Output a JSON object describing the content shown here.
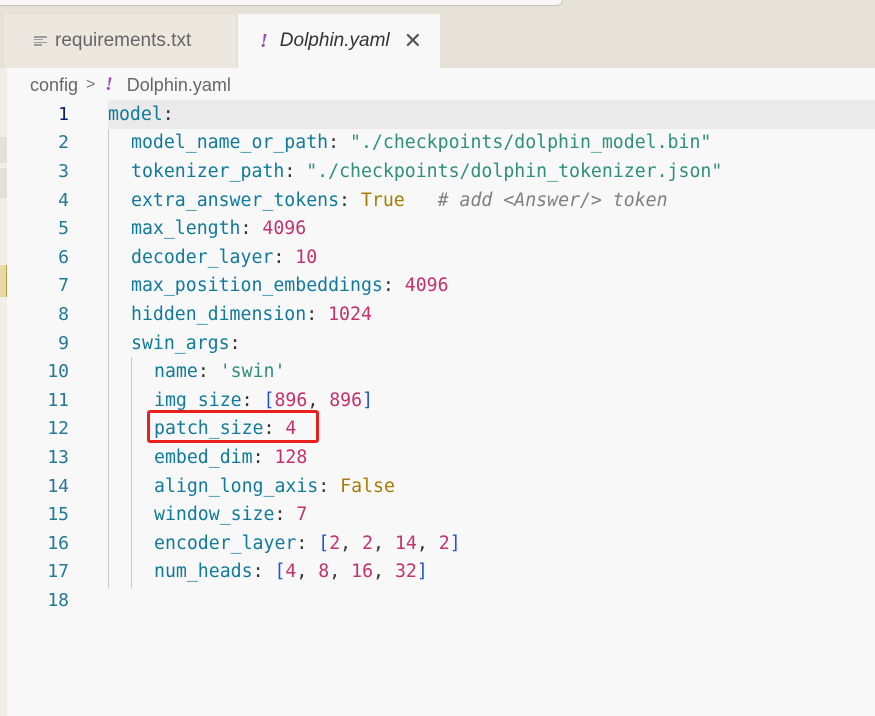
{
  "tabs": [
    {
      "label": "requirements.txt",
      "active": false
    },
    {
      "label": "Dolphin.yaml",
      "active": true,
      "icon": "!"
    }
  ],
  "breadcrumb": {
    "folder": "config",
    "separator": ">",
    "icon": "!",
    "file": "Dolphin.yaml"
  },
  "lines": [
    {
      "n": "1",
      "indent": 0,
      "tokens": [
        [
          "k",
          "model"
        ],
        [
          "p",
          ":"
        ]
      ]
    },
    {
      "n": "2",
      "indent": 1,
      "tokens": [
        [
          "k",
          "model_name_or_path"
        ],
        [
          "p",
          ": "
        ],
        [
          "s",
          "\"./checkpoints/dolphin_model.bin\""
        ]
      ]
    },
    {
      "n": "3",
      "indent": 1,
      "tokens": [
        [
          "k",
          "tokenizer_path"
        ],
        [
          "p",
          ": "
        ],
        [
          "s",
          "\"./checkpoints/dolphin_tokenizer.json\""
        ]
      ]
    },
    {
      "n": "4",
      "indent": 1,
      "tokens": [
        [
          "k",
          "extra_answer_tokens"
        ],
        [
          "p",
          ": "
        ],
        [
          "b",
          "True"
        ],
        [
          "p",
          "   "
        ],
        [
          "c",
          "# add <Answer/> token"
        ]
      ]
    },
    {
      "n": "5",
      "indent": 1,
      "tokens": [
        [
          "k",
          "max_length"
        ],
        [
          "p",
          ": "
        ],
        [
          "n",
          "4096"
        ]
      ]
    },
    {
      "n": "6",
      "indent": 1,
      "tokens": [
        [
          "k",
          "decoder_layer"
        ],
        [
          "p",
          ": "
        ],
        [
          "n",
          "10"
        ]
      ]
    },
    {
      "n": "7",
      "indent": 1,
      "tokens": [
        [
          "k",
          "max_position_embeddings"
        ],
        [
          "p",
          ": "
        ],
        [
          "n",
          "4096"
        ]
      ]
    },
    {
      "n": "8",
      "indent": 1,
      "tokens": [
        [
          "k",
          "hidden_dimension"
        ],
        [
          "p",
          ": "
        ],
        [
          "n",
          "1024"
        ]
      ]
    },
    {
      "n": "9",
      "indent": 1,
      "tokens": [
        [
          "k",
          "swin_args"
        ],
        [
          "p",
          ":"
        ]
      ]
    },
    {
      "n": "10",
      "indent": 2,
      "tokens": [
        [
          "k",
          "name"
        ],
        [
          "p",
          ": "
        ],
        [
          "s",
          "'swin'"
        ]
      ]
    },
    {
      "n": "11",
      "indent": 2,
      "tokens": [
        [
          "k",
          "img_size"
        ],
        [
          "p",
          ": "
        ],
        [
          "br",
          "["
        ],
        [
          "n",
          "896"
        ],
        [
          "p",
          ", "
        ],
        [
          "n",
          "896"
        ],
        [
          "br",
          "]"
        ]
      ]
    },
    {
      "n": "12",
      "indent": 2,
      "tokens": [
        [
          "k",
          "patch_size"
        ],
        [
          "p",
          ": "
        ],
        [
          "n",
          "4"
        ]
      ]
    },
    {
      "n": "13",
      "indent": 2,
      "tokens": [
        [
          "k",
          "embed_dim"
        ],
        [
          "p",
          ": "
        ],
        [
          "n",
          "128"
        ]
      ]
    },
    {
      "n": "14",
      "indent": 2,
      "tokens": [
        [
          "k",
          "align_long_axis"
        ],
        [
          "p",
          ": "
        ],
        [
          "b",
          "False"
        ]
      ]
    },
    {
      "n": "15",
      "indent": 2,
      "tokens": [
        [
          "k",
          "window_size"
        ],
        [
          "p",
          ": "
        ],
        [
          "n",
          "7"
        ]
      ]
    },
    {
      "n": "16",
      "indent": 2,
      "tokens": [
        [
          "k",
          "encoder_layer"
        ],
        [
          "p",
          ": "
        ],
        [
          "br",
          "["
        ],
        [
          "n",
          "2"
        ],
        [
          "p",
          ", "
        ],
        [
          "n",
          "2"
        ],
        [
          "p",
          ", "
        ],
        [
          "n",
          "14"
        ],
        [
          "p",
          ", "
        ],
        [
          "n",
          "2"
        ],
        [
          "br",
          "]"
        ]
      ]
    },
    {
      "n": "17",
      "indent": 2,
      "tokens": [
        [
          "k",
          "num_heads"
        ],
        [
          "p",
          ": "
        ],
        [
          "br",
          "["
        ],
        [
          "n",
          "4"
        ],
        [
          "p",
          ", "
        ],
        [
          "n",
          "8"
        ],
        [
          "p",
          ", "
        ],
        [
          "n",
          "16"
        ],
        [
          "p",
          ", "
        ],
        [
          "n",
          "32"
        ],
        [
          "br",
          "]"
        ]
      ]
    },
    {
      "n": "18",
      "indent": 0,
      "tokens": []
    }
  ],
  "colors": {
    "highlight_box": "#e8211f",
    "key": "#107a9a",
    "string": "#2f8f79",
    "number": "#c4326a",
    "boolean": "#a87c00"
  }
}
